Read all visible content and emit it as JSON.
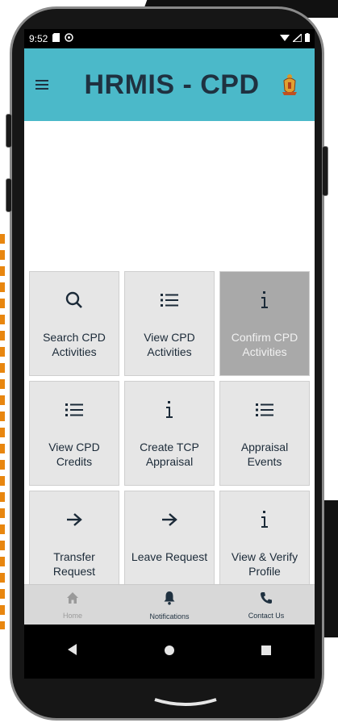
{
  "status_bar": {
    "time": "9:52"
  },
  "app_bar": {
    "title": "HRMIS - CPD"
  },
  "tiles": [
    {
      "label": "Search CPD Activities",
      "icon": "search-icon",
      "enabled": true
    },
    {
      "label": "View CPD Activities",
      "icon": "list-icon",
      "enabled": true
    },
    {
      "label": "Confirm CPD Activities",
      "icon": "info-icon",
      "enabled": false
    },
    {
      "label": "View CPD Credits",
      "icon": "list-icon",
      "enabled": true
    },
    {
      "label": "Create TCP Appraisal",
      "icon": "info-icon",
      "enabled": true
    },
    {
      "label": "Appraisal Events",
      "icon": "list-icon",
      "enabled": true
    },
    {
      "label": "Transfer Request",
      "icon": "arrow-right-icon",
      "enabled": true
    },
    {
      "label": "Leave Request",
      "icon": "arrow-right-icon",
      "enabled": true
    },
    {
      "label": "View & Verify Profile",
      "icon": "info-icon",
      "enabled": true
    }
  ],
  "bottom_nav": [
    {
      "label": "Home",
      "icon": "home-icon",
      "active": false
    },
    {
      "label": "Notifications",
      "icon": "bell-icon",
      "active": true
    },
    {
      "label": "Contact Us",
      "icon": "phone-icon",
      "active": true
    }
  ],
  "colors": {
    "app_bar": "#4bb9c9",
    "title_text": "#1f3140",
    "tile_bg": "#e6e6e6",
    "tile_disabled_bg": "#a9a9a9",
    "bottom_nav_bg": "#d8d8d8",
    "accent_orange": "#e8860f"
  }
}
